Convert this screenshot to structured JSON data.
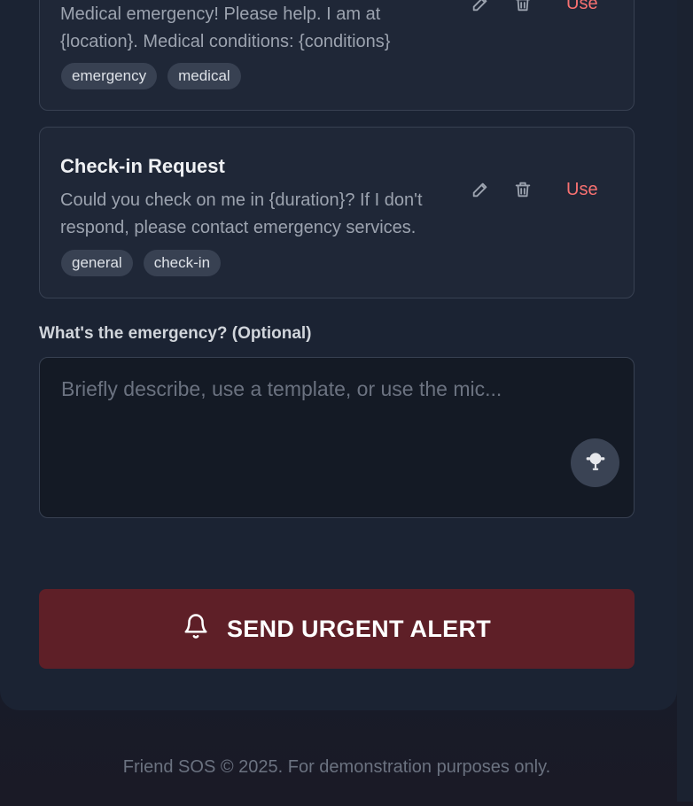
{
  "templates": [
    {
      "body": "Medical emergency! Please help. I am at {location}. Medical conditions: {conditions}",
      "tags": [
        "emergency",
        "medical"
      ],
      "use_label": "Use"
    },
    {
      "title": "Check-in Request",
      "body": "Could you check on me in {duration}? If I don't respond, please contact emergency services.",
      "tags": [
        "general",
        "check-in"
      ],
      "use_label": "Use"
    }
  ],
  "emergency_field": {
    "label": "What's the emergency? (Optional)",
    "placeholder": "Briefly describe, use a template, or use the mic...",
    "value": ""
  },
  "alert_button": {
    "label": "SEND URGENT ALERT"
  },
  "footer": {
    "text": "Friend SOS © 2025. For demonstration purposes only."
  },
  "icons": {
    "edit": "pencil-icon",
    "delete": "trash-icon",
    "mic": "microphone-icon",
    "alert": "bell-icon"
  },
  "colors": {
    "accent": "#f87171",
    "alert_button": "#5e1f27",
    "card_bg": "#1f2737",
    "tag_bg": "#384152"
  }
}
